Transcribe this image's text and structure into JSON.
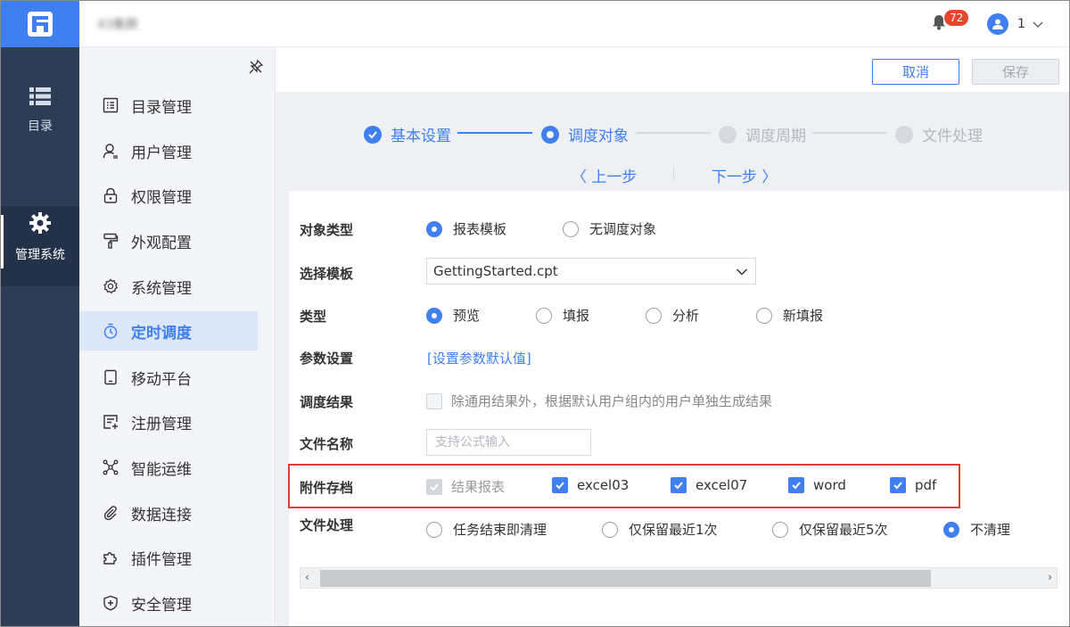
{
  "header": {
    "site_name": "43集群",
    "notification_count": "72",
    "user_name": "1"
  },
  "rail": {
    "catalog_label": "目录",
    "system_label": "管理系统"
  },
  "menu": {
    "items": [
      {
        "label": "目录管理",
        "icon": "catalog-icon"
      },
      {
        "label": "用户管理",
        "icon": "user-icon"
      },
      {
        "label": "权限管理",
        "icon": "lock-icon"
      },
      {
        "label": "外观配置",
        "icon": "paint-roller-icon"
      },
      {
        "label": "系统管理",
        "icon": "gear-icon"
      },
      {
        "label": "定时调度",
        "icon": "timer-icon"
      },
      {
        "label": "移动平台",
        "icon": "tablet-icon"
      },
      {
        "label": "注册管理",
        "icon": "register-icon"
      },
      {
        "label": "智能运维",
        "icon": "network-icon"
      },
      {
        "label": "数据连接",
        "icon": "paperclip-icon"
      },
      {
        "label": "插件管理",
        "icon": "puzzle-icon"
      },
      {
        "label": "安全管理",
        "icon": "shield-icon"
      }
    ],
    "active_index": 5
  },
  "toolbar": {
    "cancel_label": "取消",
    "save_label": "保存"
  },
  "steps": [
    {
      "label": "基本设置",
      "state": "done"
    },
    {
      "label": "调度对象",
      "state": "current"
    },
    {
      "label": "调度周期",
      "state": "pending"
    },
    {
      "label": "文件处理",
      "state": "pending"
    }
  ],
  "nav": {
    "prev_label": "上一步",
    "next_label": "下一步"
  },
  "form": {
    "object_type": {
      "label": "对象类型",
      "options": [
        "报表模板",
        "无调度对象"
      ],
      "selected": 0
    },
    "template": {
      "label": "选择模板",
      "value": "GettingStarted.cpt"
    },
    "type": {
      "label": "类型",
      "options": [
        "预览",
        "填报",
        "分析",
        "新填报"
      ],
      "selected": 0
    },
    "params": {
      "label": "参数设置",
      "link": "[设置参数默认值]"
    },
    "result": {
      "label": "调度结果",
      "text": "除通用结果外，根据默认用户组内的用户单独生成结果",
      "checked": false
    },
    "filename": {
      "label": "文件名称",
      "placeholder": "支持公式输入",
      "value": ""
    },
    "attachments": {
      "label": "附件存档",
      "options": [
        {
          "label": "结果报表",
          "checked": true,
          "disabled": true
        },
        {
          "label": "excel03",
          "checked": true
        },
        {
          "label": "excel07",
          "checked": true
        },
        {
          "label": "word",
          "checked": true
        },
        {
          "label": "pdf",
          "checked": true
        }
      ]
    },
    "file_processing": {
      "label": "文件处理",
      "options": [
        "任务结束即清理",
        "仅保留最近1次",
        "仅保留最近5次",
        "不清理"
      ],
      "selected": 3
    }
  },
  "colors": {
    "accent": "#3f7ff0",
    "rail": "#2d3d56",
    "highlight": "#e13b3b"
  }
}
